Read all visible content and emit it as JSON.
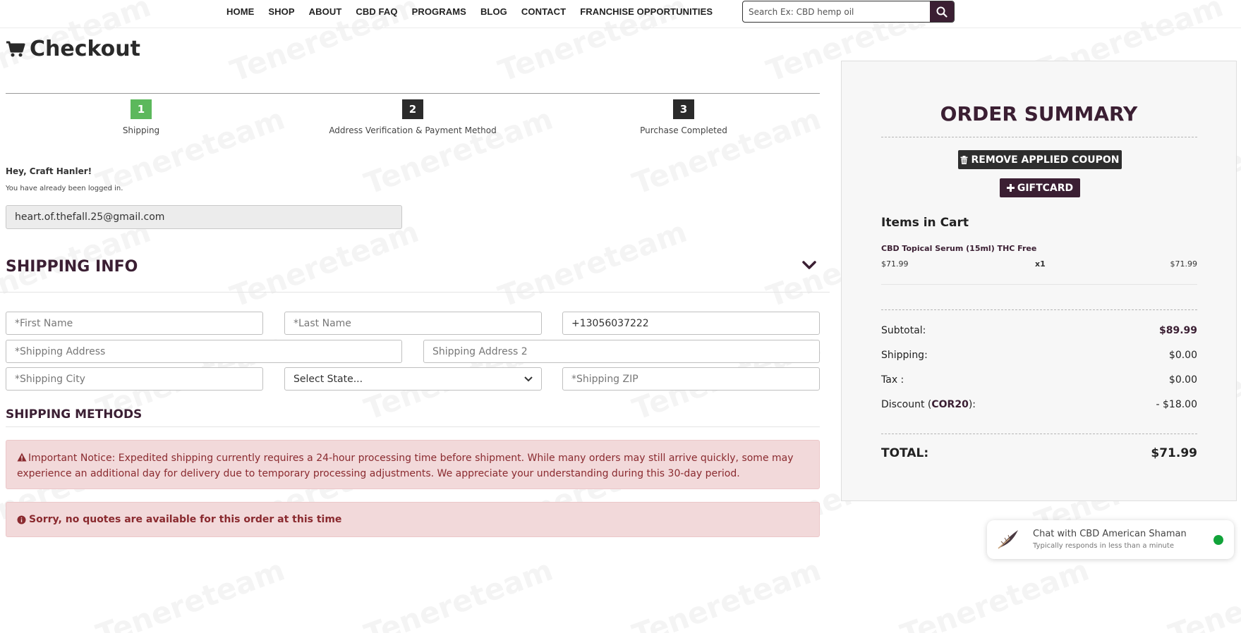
{
  "nav": {
    "links": [
      "HOME",
      "SHOP",
      "ABOUT",
      "CBD FAQ",
      "PROGRAMS",
      "BLOG",
      "CONTACT",
      "FRANCHISE OPPORTUNITIES"
    ],
    "search_placeholder": "Search Ex: CBD hemp oil"
  },
  "watermark": "Tenereteam",
  "checkout": {
    "title": "Checkout",
    "steps": [
      {
        "num": "1",
        "label": "Shipping",
        "state": "active"
      },
      {
        "num": "2",
        "label": "Address Verification & Payment Method",
        "state": "pending"
      },
      {
        "num": "3",
        "label": "Purchase Completed",
        "state": "pending"
      }
    ],
    "greeting": "Hey, Craft Hanler!",
    "logged_in_text": "You have already been logged in.",
    "email": "heart.of.thefall.25@gmail.com"
  },
  "shipping_info": {
    "header": "SHIPPING INFO",
    "first_name_placeholder": "*First Name",
    "last_name_placeholder": "*Last Name",
    "phone_value": "+13056037222",
    "address_placeholder": "*Shipping Address",
    "address2_placeholder": "Shipping Address 2",
    "city_placeholder": "*Shipping City",
    "state_selected": "Select State...",
    "zip_placeholder": "*Shipping ZIP"
  },
  "shipping_methods": {
    "header": "SHIPPING METHODS",
    "notice": "Important Notice: Expedited shipping currently requires a 24-hour processing time before shipment. While many orders may still arrive quickly, some may experience an additional day for delivery due to temporary processing adjustments. We appreciate your understanding during this 30-day period.",
    "no_quotes": "Sorry, no quotes are available for this order at this time"
  },
  "order_summary": {
    "title": "ORDER SUMMARY",
    "remove_coupon_label": "REMOVE APPLIED COUPON",
    "giftcard_label": "GIFTCARD",
    "items_title": "Items in Cart",
    "item": {
      "name": "CBD Topical Serum (15ml) THC Free",
      "price": "$71.99",
      "qty": "x1",
      "total": "$71.99"
    },
    "subtotal_label": "Subtotal:",
    "subtotal_value": "$89.99",
    "shipping_label": "Shipping:",
    "shipping_value": "$0.00",
    "tax_label": "Tax :",
    "tax_value": "$0.00",
    "discount_prefix": "Discount (",
    "discount_code": "COR20",
    "discount_suffix": "):",
    "discount_value": "- $18.00",
    "total_label": "TOTAL:",
    "total_value": "$71.99"
  },
  "chat": {
    "title": "Chat with CBD American Shaman",
    "subtitle": "Typically responds in less than a minute"
  },
  "colors": {
    "brand_plum": "#3b1f33",
    "step_active": "#5cb85c",
    "step_pending": "#2b2b2b",
    "alert_bg": "#f2d9da",
    "alert_text": "#8a2a2f",
    "online": "#11a33a"
  }
}
